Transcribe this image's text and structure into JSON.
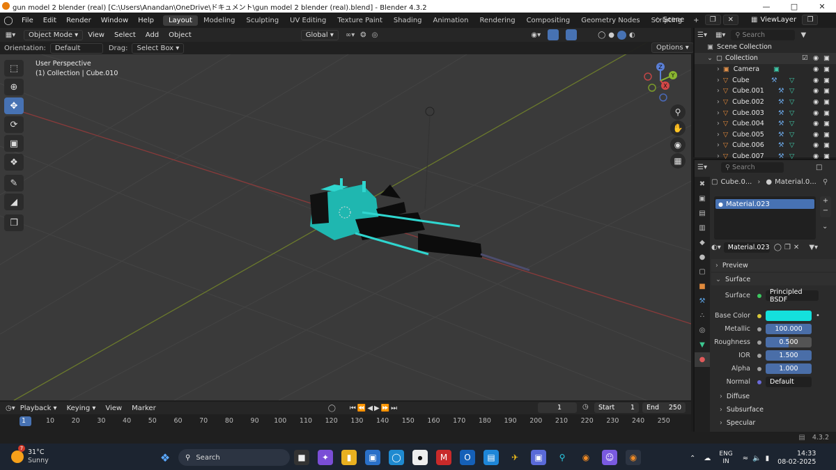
{
  "window": {
    "title": "gun model 2 blender (real) [C:\\Users\\Anandan\\OneDrive\\ドキュメント\\gun model 2 blender (real).blend] - Blender 4.3.2"
  },
  "menu": {
    "file": "File",
    "edit": "Edit",
    "render": "Render",
    "window": "Window",
    "help": "Help"
  },
  "workspaces": [
    "Layout",
    "Modeling",
    "Sculpting",
    "UV Editing",
    "Texture Paint",
    "Shading",
    "Animation",
    "Rendering",
    "Compositing",
    "Geometry Nodes",
    "Scripting"
  ],
  "scene": {
    "name": "Scene",
    "viewlayer": "ViewLayer"
  },
  "viewport": {
    "mode": "Object Mode",
    "menus": [
      "View",
      "Select",
      "Add",
      "Object"
    ],
    "transform": "Global",
    "options": "Options",
    "orientation_label": "Orientation:",
    "orientation_value": "Default",
    "drag_label": "Drag:",
    "drag_value": "Select Box",
    "perspective": "User Perspective",
    "collection_info": "(1) Collection | Cube.010"
  },
  "gizmo": {
    "x": "X",
    "y": "Y",
    "z": "Z"
  },
  "outliner": {
    "search_placeholder": "Search",
    "scene_collection": "Scene Collection",
    "collection": "Collection",
    "items": [
      "Camera",
      "Cube",
      "Cube.001",
      "Cube.002",
      "Cube.003",
      "Cube.004",
      "Cube.005",
      "Cube.006",
      "Cube.007"
    ]
  },
  "properties": {
    "search_placeholder": "Search",
    "breadcrumb_object": "Cube.0...",
    "breadcrumb_material": "Material.0...",
    "slot_material": "Material.023",
    "material_name": "Material.023",
    "sections": {
      "preview": "Preview",
      "surface": "Surface",
      "diffuse": "Diffuse",
      "subsurface": "Subsurface",
      "specular": "Specular"
    },
    "surface_label": "Surface",
    "surface_value": "Principled BSDF",
    "fields": [
      {
        "label": "Base Color",
        "value": ""
      },
      {
        "label": "Metallic",
        "value": "100.000"
      },
      {
        "label": "Roughness",
        "value": "0.500"
      },
      {
        "label": "IOR",
        "value": "1.500"
      },
      {
        "label": "Alpha",
        "value": "1.000"
      },
      {
        "label": "Normal",
        "value": "Default"
      }
    ],
    "base_color": "#14e0dc"
  },
  "timeline": {
    "playback": "Playback",
    "keying": "Keying",
    "view": "View",
    "marker": "Marker",
    "current_frame": "1",
    "start_label": "Start",
    "start": "1",
    "end_label": "End",
    "end": "250",
    "ticks": [
      "1",
      "10",
      "20",
      "30",
      "40",
      "50",
      "60",
      "70",
      "80",
      "90",
      "100",
      "110",
      "120",
      "130",
      "140",
      "150",
      "160",
      "170",
      "180",
      "190",
      "200",
      "210",
      "220",
      "230",
      "240",
      "250"
    ]
  },
  "status": {
    "version": "4.3.2"
  },
  "taskbar": {
    "weather_temp": "31°C",
    "weather_desc": "Sunny",
    "weather_badge": "7",
    "search": "Search",
    "lang": "ENG",
    "region": "IN",
    "time": "14:33",
    "date": "08-02-2025"
  }
}
